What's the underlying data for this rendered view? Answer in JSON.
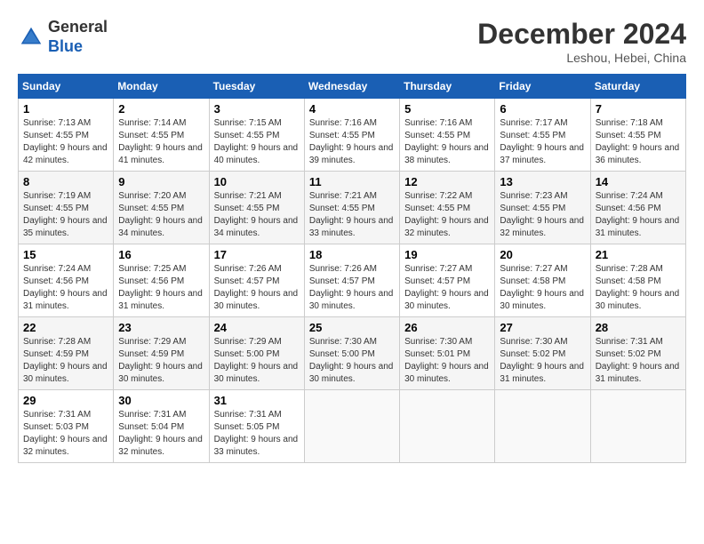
{
  "logo": {
    "line1": "General",
    "line2": "Blue"
  },
  "title": "December 2024",
  "location": "Leshou, Hebei, China",
  "headers": [
    "Sunday",
    "Monday",
    "Tuesday",
    "Wednesday",
    "Thursday",
    "Friday",
    "Saturday"
  ],
  "weeks": [
    [
      {
        "day": "1",
        "sunrise": "7:13 AM",
        "sunset": "4:55 PM",
        "daylight": "9 hours and 42 minutes."
      },
      {
        "day": "2",
        "sunrise": "7:14 AM",
        "sunset": "4:55 PM",
        "daylight": "9 hours and 41 minutes."
      },
      {
        "day": "3",
        "sunrise": "7:15 AM",
        "sunset": "4:55 PM",
        "daylight": "9 hours and 40 minutes."
      },
      {
        "day": "4",
        "sunrise": "7:16 AM",
        "sunset": "4:55 PM",
        "daylight": "9 hours and 39 minutes."
      },
      {
        "day": "5",
        "sunrise": "7:16 AM",
        "sunset": "4:55 PM",
        "daylight": "9 hours and 38 minutes."
      },
      {
        "day": "6",
        "sunrise": "7:17 AM",
        "sunset": "4:55 PM",
        "daylight": "9 hours and 37 minutes."
      },
      {
        "day": "7",
        "sunrise": "7:18 AM",
        "sunset": "4:55 PM",
        "daylight": "9 hours and 36 minutes."
      }
    ],
    [
      {
        "day": "8",
        "sunrise": "7:19 AM",
        "sunset": "4:55 PM",
        "daylight": "9 hours and 35 minutes."
      },
      {
        "day": "9",
        "sunrise": "7:20 AM",
        "sunset": "4:55 PM",
        "daylight": "9 hours and 34 minutes."
      },
      {
        "day": "10",
        "sunrise": "7:21 AM",
        "sunset": "4:55 PM",
        "daylight": "9 hours and 34 minutes."
      },
      {
        "day": "11",
        "sunrise": "7:21 AM",
        "sunset": "4:55 PM",
        "daylight": "9 hours and 33 minutes."
      },
      {
        "day": "12",
        "sunrise": "7:22 AM",
        "sunset": "4:55 PM",
        "daylight": "9 hours and 32 minutes."
      },
      {
        "day": "13",
        "sunrise": "7:23 AM",
        "sunset": "4:55 PM",
        "daylight": "9 hours and 32 minutes."
      },
      {
        "day": "14",
        "sunrise": "7:24 AM",
        "sunset": "4:56 PM",
        "daylight": "9 hours and 31 minutes."
      }
    ],
    [
      {
        "day": "15",
        "sunrise": "7:24 AM",
        "sunset": "4:56 PM",
        "daylight": "9 hours and 31 minutes."
      },
      {
        "day": "16",
        "sunrise": "7:25 AM",
        "sunset": "4:56 PM",
        "daylight": "9 hours and 31 minutes."
      },
      {
        "day": "17",
        "sunrise": "7:26 AM",
        "sunset": "4:57 PM",
        "daylight": "9 hours and 30 minutes."
      },
      {
        "day": "18",
        "sunrise": "7:26 AM",
        "sunset": "4:57 PM",
        "daylight": "9 hours and 30 minutes."
      },
      {
        "day": "19",
        "sunrise": "7:27 AM",
        "sunset": "4:57 PM",
        "daylight": "9 hours and 30 minutes."
      },
      {
        "day": "20",
        "sunrise": "7:27 AM",
        "sunset": "4:58 PM",
        "daylight": "9 hours and 30 minutes."
      },
      {
        "day": "21",
        "sunrise": "7:28 AM",
        "sunset": "4:58 PM",
        "daylight": "9 hours and 30 minutes."
      }
    ],
    [
      {
        "day": "22",
        "sunrise": "7:28 AM",
        "sunset": "4:59 PM",
        "daylight": "9 hours and 30 minutes."
      },
      {
        "day": "23",
        "sunrise": "7:29 AM",
        "sunset": "4:59 PM",
        "daylight": "9 hours and 30 minutes."
      },
      {
        "day": "24",
        "sunrise": "7:29 AM",
        "sunset": "5:00 PM",
        "daylight": "9 hours and 30 minutes."
      },
      {
        "day": "25",
        "sunrise": "7:30 AM",
        "sunset": "5:00 PM",
        "daylight": "9 hours and 30 minutes."
      },
      {
        "day": "26",
        "sunrise": "7:30 AM",
        "sunset": "5:01 PM",
        "daylight": "9 hours and 30 minutes."
      },
      {
        "day": "27",
        "sunrise": "7:30 AM",
        "sunset": "5:02 PM",
        "daylight": "9 hours and 31 minutes."
      },
      {
        "day": "28",
        "sunrise": "7:31 AM",
        "sunset": "5:02 PM",
        "daylight": "9 hours and 31 minutes."
      }
    ],
    [
      {
        "day": "29",
        "sunrise": "7:31 AM",
        "sunset": "5:03 PM",
        "daylight": "9 hours and 32 minutes."
      },
      {
        "day": "30",
        "sunrise": "7:31 AM",
        "sunset": "5:04 PM",
        "daylight": "9 hours and 32 minutes."
      },
      {
        "day": "31",
        "sunrise": "7:31 AM",
        "sunset": "5:05 PM",
        "daylight": "9 hours and 33 minutes."
      },
      null,
      null,
      null,
      null
    ]
  ]
}
